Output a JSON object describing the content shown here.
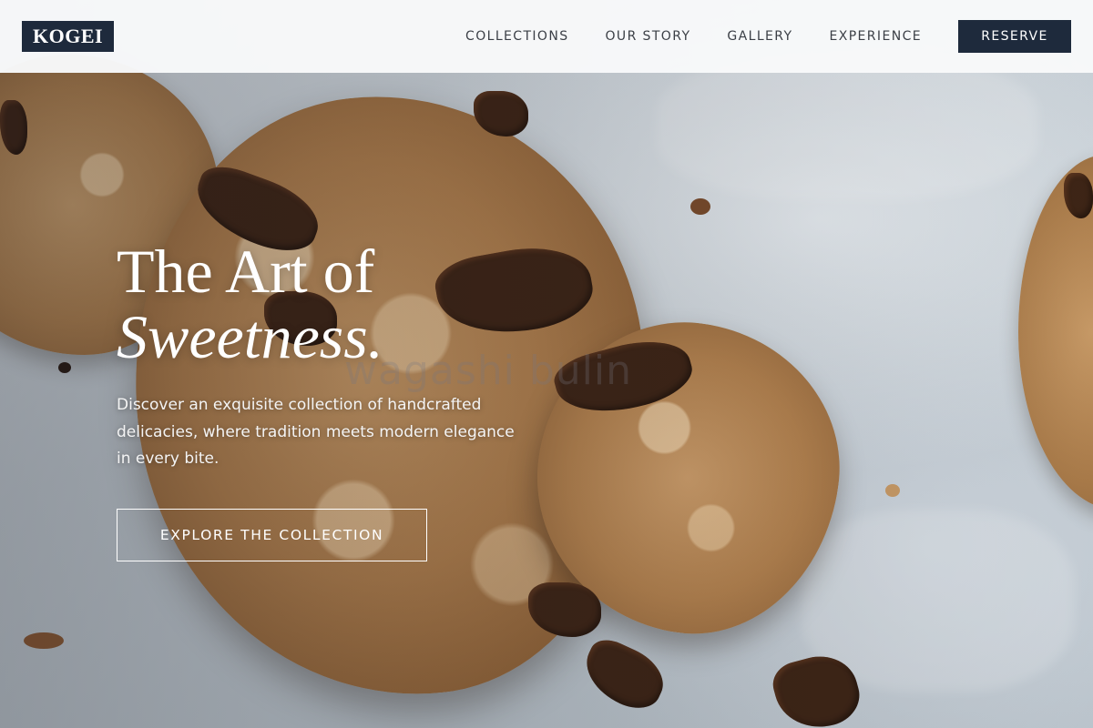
{
  "brand": {
    "logo_text": "KOGEI"
  },
  "nav": {
    "links": [
      "COLLECTIONS",
      "OUR STORY",
      "GALLERY",
      "EXPERIENCE"
    ],
    "reserve_label": "RESERVE"
  },
  "hero": {
    "title_line1": "The Art of",
    "title_line2": "Sweetness.",
    "watermark": "wagashi bulin",
    "description": "Discover an exquisite collection of handcrafted delicacies, where tradition meets modern elegance in every bite.",
    "cta_label": "EXPLORE THE COLLECTION",
    "image_subject": "chocolate chip cookies on parchment paper"
  },
  "colors": {
    "brand_navy": "#1e2a3c",
    "nav_bg": "#f8f9fa",
    "hero_text": "#ffffff"
  }
}
